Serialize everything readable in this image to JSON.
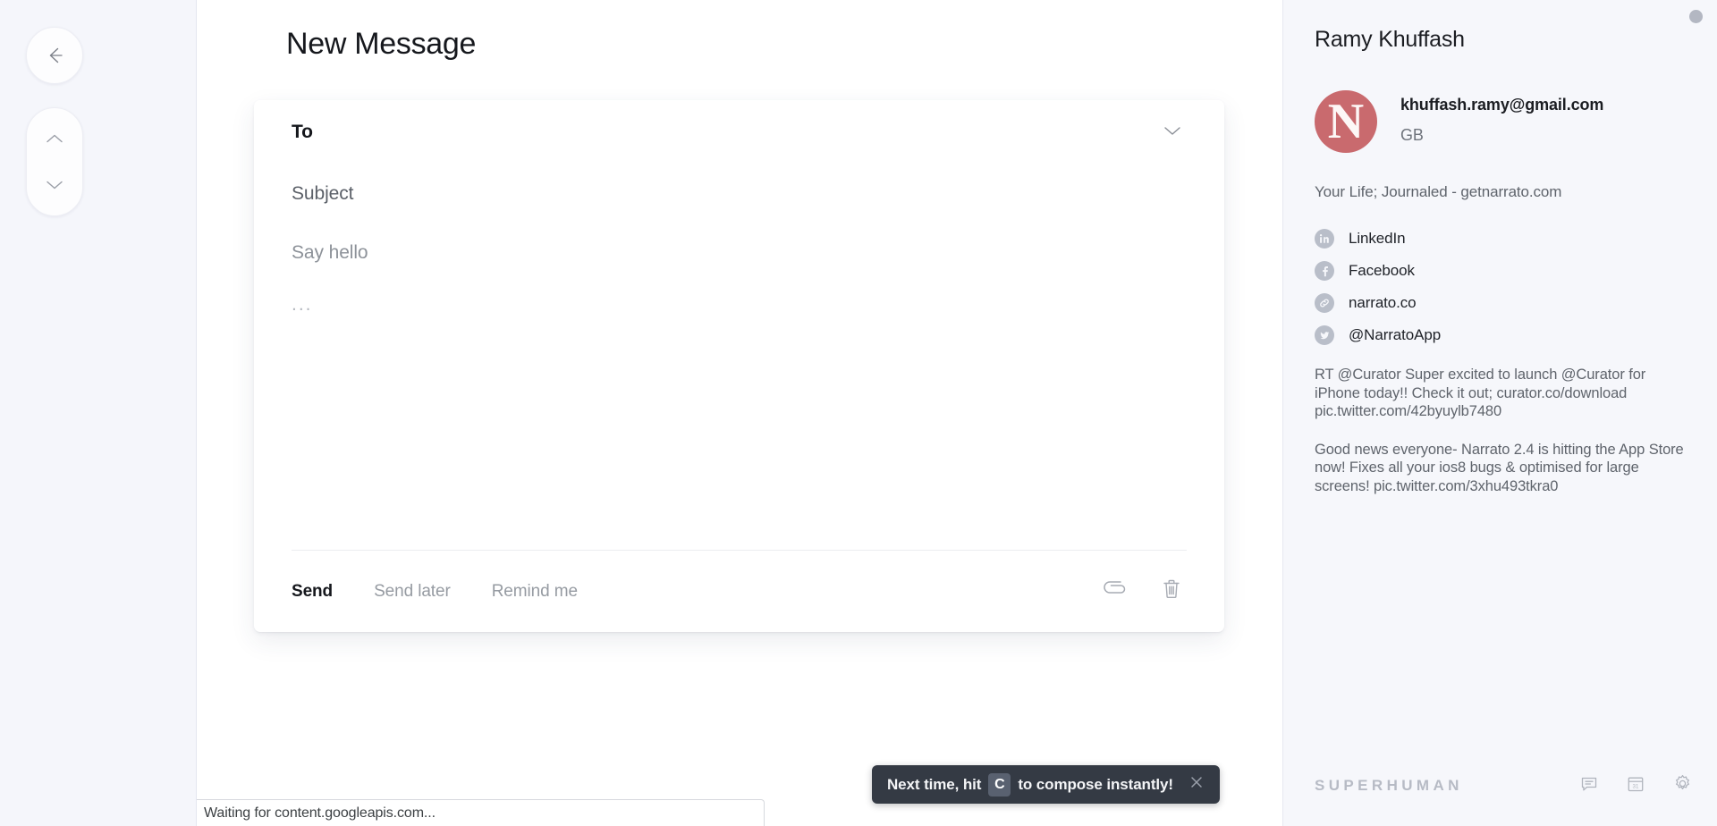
{
  "left_rail": {
    "back_icon": "arrow-left-icon",
    "prev_icon": "chevron-up-icon",
    "next_icon": "chevron-down-icon"
  },
  "compose": {
    "title": "New Message",
    "to_label": "To",
    "to_value": "",
    "to_expand_icon": "chevron-down-icon",
    "subject_label": "Subject",
    "subject_value": "",
    "body_greeting": "Say hello",
    "body_placeholder_dots": "...",
    "actions": {
      "send": "Send",
      "send_later": "Send later",
      "remind_me": "Remind me",
      "attach_icon": "paperclip-icon",
      "discard_icon": "trash-icon"
    }
  },
  "contact": {
    "name": "Ramy Khuffash",
    "avatar_letter": "N",
    "avatar_color": "#c96a6e",
    "email": "khuffash.ramy@gmail.com",
    "country": "GB",
    "tagline": "Your Life; Journaled - getnarrato.com",
    "socials": [
      {
        "icon": "linkedin-icon",
        "label": "LinkedIn"
      },
      {
        "icon": "facebook-icon",
        "label": "Facebook"
      },
      {
        "icon": "link-icon",
        "label": "narrato.co"
      },
      {
        "icon": "twitter-icon",
        "label": "@NarratoApp"
      }
    ],
    "tweets": [
      "RT @Curator Super excited to launch @Curator for iPhone today!! Check it out; curator.co/download pic.twitter.com/42byuylb7480",
      "Good news everyone- Narrato 2.4 is hitting the App Store now! Fixes all your ios8 bugs & optimised for large screens! pic.twitter.com/3xhu493tkra0"
    ],
    "status_dot_color": "#b3b7c2"
  },
  "panel_footer": {
    "brand": "SUPERHUMAN",
    "icons": [
      {
        "icon": "chat-bubble-icon",
        "label": "Feedback"
      },
      {
        "icon": "calendar-icon",
        "label": "Calendar",
        "day": "31"
      },
      {
        "icon": "gear-icon",
        "label": "Settings"
      }
    ]
  },
  "toast": {
    "text_before": "Next time, hit",
    "key": "C",
    "text_after": "to compose instantly!",
    "close_icon": "close-icon",
    "background": "#343a44"
  },
  "status_bar": {
    "text": "Waiting for content.googleapis.com..."
  }
}
